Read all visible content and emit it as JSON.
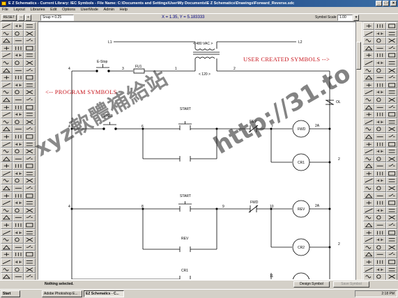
{
  "window": {
    "title": "E Z Schematics - Current Library: IEC Symbols - File Name: C:\\Documents and Settings\\User\\My Documents\\E Z Schematics\\Drawings\\Forward_Reverse.sdc",
    "minimize": "_",
    "maximize": "□",
    "close": "×"
  },
  "menu": [
    "File",
    "Layout",
    "Libraries",
    "Edit",
    "Options",
    "UserMode",
    "Admin",
    "Help"
  ],
  "toolbar": {
    "reset": "RESET",
    "snap_label": "Snap = 0.25",
    "coordinates": "X = 1.35, Y = 5.183333",
    "symbol_scale_label": "Symbol Scale",
    "symbol_scale_value": "1.00"
  },
  "diagram": {
    "lines": [
      "L1",
      "L2"
    ],
    "transformer_primary": "< 480 VAC >",
    "transformer_secondary": "< 120 >",
    "wires": [
      "4",
      "3",
      "1",
      "2",
      "4",
      "6",
      "7",
      "2",
      "4",
      "8",
      "9",
      "10",
      "2",
      "11"
    ],
    "components": {
      "estop": "E-Stop",
      "fuse": "FU1",
      "ol": "OL",
      "stop": "STOP",
      "start1": "START",
      "rev_interlock": "REV",
      "fwd_coil": "FWD",
      "fwd_coil_contacts": "2A",
      "cr1": "CR1",
      "start2": "START",
      "fwd_interlock": "FWD",
      "rev_coil": "REV",
      "rev_coil_contacts": "2A",
      "rev_contact": "REV",
      "cr2": "CR2",
      "cr1_bottom": "CR1"
    },
    "annotations": {
      "user_created": "USER CREATED SYMBOLS -->",
      "program_symbols": "<-- PROGRAM SYMBOLS"
    }
  },
  "status": {
    "message": "Nothing selected.",
    "design_symbol": "Design Symbol",
    "save_symbol": "Save Symbol"
  },
  "taskbar": {
    "start": "Start",
    "tasks": [
      "Adobe Photoshop E...",
      "EZ Schematics - C..."
    ],
    "clock": "2:18 PM"
  },
  "watermark": {
    "brand": "xyz軟體補給站",
    "url": "http://31.to"
  },
  "colors": {
    "annotation": "#c8161d",
    "titlebar_start": "#0a246a",
    "titlebar_end": "#3a6ea5",
    "window_face": "#d4d0c8"
  }
}
